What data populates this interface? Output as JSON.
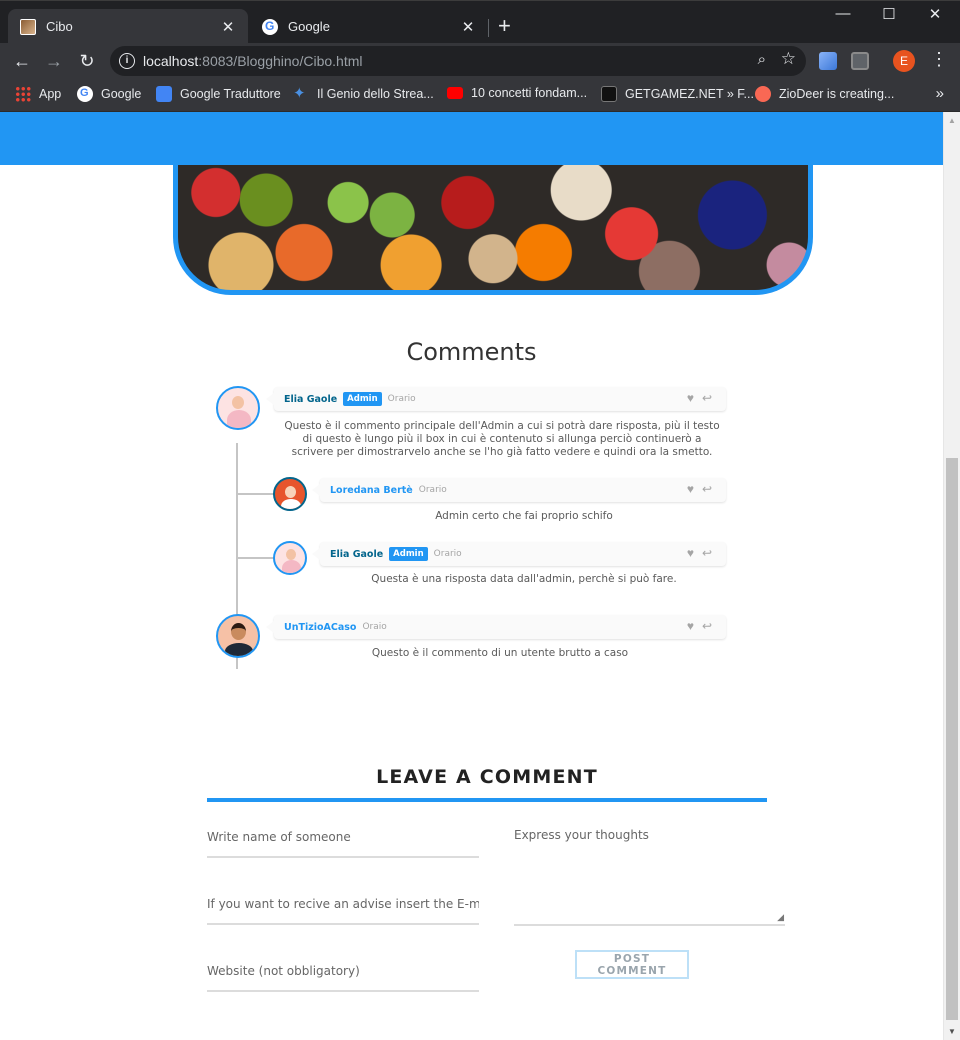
{
  "browser": {
    "tabs": [
      {
        "title": "Cibo",
        "active": true
      },
      {
        "title": "Google",
        "active": false
      }
    ],
    "url_host": "localhost",
    "url_path": ":8083/Blogghino/Cibo.html",
    "profile_initial": "E",
    "bookmarks": [
      {
        "label": "App",
        "icon": "apps-icon"
      },
      {
        "label": "Google",
        "icon": "google-icon"
      },
      {
        "label": "Google Traduttore",
        "icon": "translate-icon"
      },
      {
        "label": "Il Genio dello Strea...",
        "icon": "genio-icon"
      },
      {
        "label": "10 concetti fondam...",
        "icon": "youtube-icon"
      },
      {
        "label": "GETGAMEZ.NET » F...",
        "icon": "getgamez-icon"
      },
      {
        "label": "ZioDeer is creating...",
        "icon": "patreon-icon"
      }
    ]
  },
  "colors": {
    "accent": "#2196f3",
    "admin_name": "#03658c"
  },
  "comments": {
    "title": "Comments",
    "items": [
      {
        "name": "Elia Gaole",
        "badge": "Admin",
        "time": "Orario",
        "text": "Questo è il commento principale dell'Admin a cui si potrà dare risposta, più il testo di questo è lungo più il box in cui è contenuto si allunga perciò continuerò a scrivere per dimostrarvelo anche se l'ho già fatto vedere e quindi ora la smetto."
      },
      {
        "name": "Loredana Bertè",
        "time": "Orario",
        "text": "Admin certo che fai proprio schifo"
      },
      {
        "name": "Elia Gaole",
        "badge": "Admin",
        "time": "Orario",
        "text": "Questa è una risposta data dall'admin, perchè si può fare."
      },
      {
        "name": "UnTizioACaso",
        "time": "Oraio",
        "text": "Questo è il commento di un utente brutto a caso"
      }
    ]
  },
  "form": {
    "title": "LEAVE A COMMENT",
    "name_placeholder": "Write name of someone",
    "email_placeholder": "If you want to recive an advise insert the E-mail",
    "website_placeholder": "Website (not obbligatory)",
    "thoughts_placeholder": "Express your thoughts",
    "submit_label": "POST COMMENT"
  }
}
